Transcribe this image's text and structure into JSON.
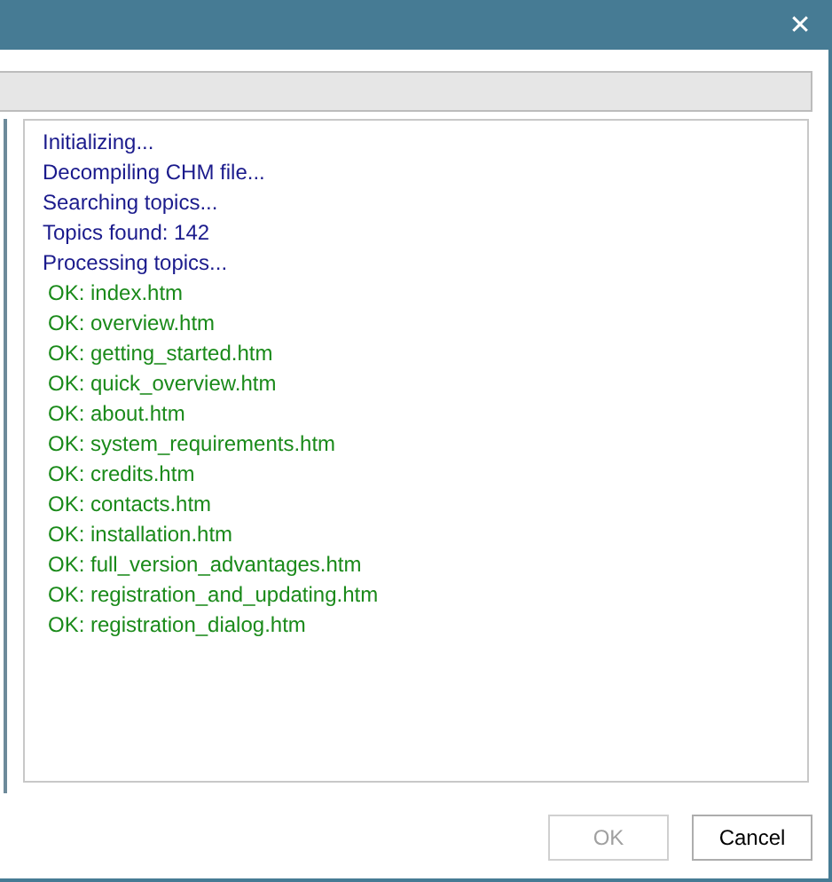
{
  "window": {
    "close_glyph": "✕"
  },
  "progress": {
    "level": 0
  },
  "log": [
    {
      "kind": "status",
      "text": "Initializing..."
    },
    {
      "kind": "status",
      "text": "Decompiling CHM file..."
    },
    {
      "kind": "status",
      "text": "Searching topics..."
    },
    {
      "kind": "status",
      "text": "Topics found: 142"
    },
    {
      "kind": "status",
      "text": "Processing topics..."
    },
    {
      "kind": "ok",
      "text": "OK: index.htm"
    },
    {
      "kind": "ok",
      "text": "OK: overview.htm"
    },
    {
      "kind": "ok",
      "text": "OK: getting_started.htm"
    },
    {
      "kind": "ok",
      "text": "OK: quick_overview.htm"
    },
    {
      "kind": "ok",
      "text": "OK: about.htm"
    },
    {
      "kind": "ok",
      "text": "OK: system_requirements.htm"
    },
    {
      "kind": "ok",
      "text": "OK: credits.htm"
    },
    {
      "kind": "ok",
      "text": "OK: contacts.htm"
    },
    {
      "kind": "ok",
      "text": "OK: installation.htm"
    },
    {
      "kind": "ok",
      "text": "OK: full_version_advantages.htm"
    },
    {
      "kind": "ok",
      "text": "OK: registration_and_updating.htm"
    },
    {
      "kind": "ok",
      "text": "OK: registration_dialog.htm"
    }
  ],
  "buttons": [
    {
      "label": "OK",
      "disabled": true
    },
    {
      "label": "Cancel",
      "disabled": false
    }
  ]
}
